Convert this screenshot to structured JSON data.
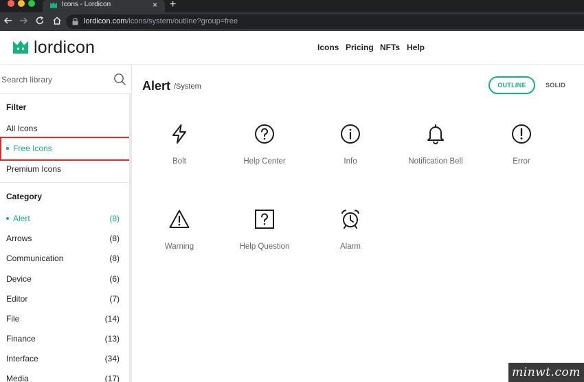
{
  "browser": {
    "tab_title": "Icons - Lordicon",
    "new_tab": "+",
    "tab_close": "×",
    "url_host": "lordicon.com",
    "url_path": "/icons/system/outline?group=free"
  },
  "header": {
    "logo_text": "lordicon",
    "nav": [
      "Icons",
      "Pricing",
      "NFTs",
      "Help"
    ]
  },
  "sidebar": {
    "search_placeholder": "Search library",
    "filter_title": "Filter",
    "filters": [
      {
        "label": "All Icons",
        "active": false
      },
      {
        "label": "Free Icons",
        "active": true
      },
      {
        "label": "Premium Icons",
        "active": false
      }
    ],
    "category_title": "Category",
    "categories": [
      {
        "label": "Alert",
        "count": "(8)",
        "active": true
      },
      {
        "label": "Arrows",
        "count": "(8)",
        "active": false
      },
      {
        "label": "Communication",
        "count": "(8)",
        "active": false
      },
      {
        "label": "Device",
        "count": "(6)",
        "active": false
      },
      {
        "label": "Editor",
        "count": "(7)",
        "active": false
      },
      {
        "label": "File",
        "count": "(14)",
        "active": false
      },
      {
        "label": "Finance",
        "count": "(13)",
        "active": false
      },
      {
        "label": "Interface",
        "count": "(34)",
        "active": false
      },
      {
        "label": "Media",
        "count": "(17)",
        "active": false
      }
    ]
  },
  "main": {
    "title": "Alert",
    "crumb": "/System",
    "style_outline": "OUTLINE",
    "style_solid": "SOLID",
    "icons": [
      {
        "label": "Bolt",
        "icon": "bolt-icon"
      },
      {
        "label": "Help Center",
        "icon": "help-center-icon"
      },
      {
        "label": "Info",
        "icon": "info-icon"
      },
      {
        "label": "Notification Bell",
        "icon": "notification-bell-icon"
      },
      {
        "label": "Error",
        "icon": "error-icon"
      },
      {
        "label": "Warning",
        "icon": "warning-icon"
      },
      {
        "label": "Help Question",
        "icon": "help-question-icon"
      },
      {
        "label": "Alarm",
        "icon": "alarm-icon"
      }
    ]
  },
  "watermark": "minwt.com",
  "colors": {
    "accent": "#16b281",
    "highlight": "#e02b2b",
    "chrome_dark": "#35363a"
  }
}
